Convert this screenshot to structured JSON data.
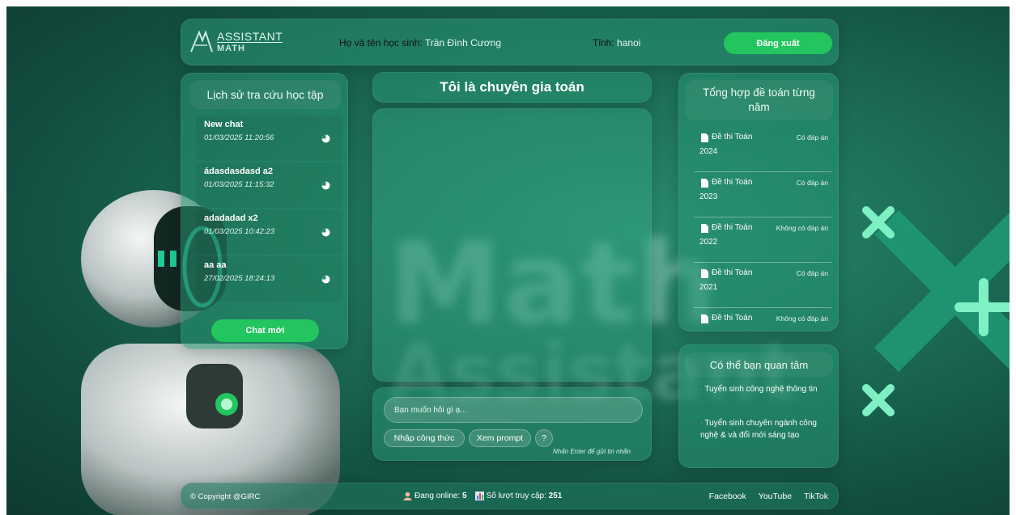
{
  "header": {
    "logo_line1": "ASSISTANT",
    "logo_line2": "MATH",
    "student_label": "Họ và tên học sinh:",
    "student_name": "Trần Đình Cương",
    "province_label": "Tỉnh:",
    "province_value": "hanoi",
    "logout_label": "Đăng xuất"
  },
  "history": {
    "title": "Lịch sử tra cứu học tập",
    "items": [
      {
        "title": "New chat",
        "time": "01/03/2025 11:20:56"
      },
      {
        "title": "ádasdasdasd a2",
        "time": "01/03/2025 11:15:32"
      },
      {
        "title": "adadadad x2",
        "time": "01/03/2025 10:42:23"
      },
      {
        "title": "aa aa",
        "time": "27/02/2025 18:24:13"
      }
    ],
    "new_chat_label": "Chat mới"
  },
  "center": {
    "title": "Tôi là chuyên gia toán",
    "input_placeholder": "Bạn muốn hỏi gì ạ...",
    "formula_button": "Nhập công thức",
    "prompt_button": "Xem prompt",
    "help_button": "?",
    "enter_hint": "Nhấn Enter để gửi tin nhắn"
  },
  "exams": {
    "title": "Tổng hợp đề toán từng năm",
    "items": [
      {
        "label": "Đề thi Toán",
        "answer": "Có đáp án",
        "year": "2024"
      },
      {
        "label": "Đề thi Toán",
        "answer": "Có đáp án",
        "year": "2023"
      },
      {
        "label": "Đề thi Toán",
        "answer": "Không có đáp án",
        "year": "2022"
      },
      {
        "label": "Đề thi Toán",
        "answer": "Có đáp án",
        "year": "2021"
      },
      {
        "label": "Đề thi Toán",
        "answer": "Không có đáp án",
        "year": ""
      }
    ]
  },
  "interest": {
    "title": "Có thể bạn quan tâm",
    "items": [
      "Tuyển sinh công nghệ thông tin",
      "Tuyển sinh chuyên ngành công nghệ & và đổi mới sáng tạo"
    ]
  },
  "footer": {
    "copyright": "© Copyright @GIRC",
    "online_label": "Đang online:",
    "online_count": "5",
    "visits_label": "Số lượt truy cập:",
    "visits_count": "251",
    "socials": [
      "Facebook",
      "YouTube",
      "TikTok"
    ]
  },
  "colors": {
    "accent_green": "#22c55e",
    "background": "#1d6f58",
    "panel": "#28966f"
  },
  "background_text": {
    "word1": "Math",
    "word2": "Assistant"
  }
}
